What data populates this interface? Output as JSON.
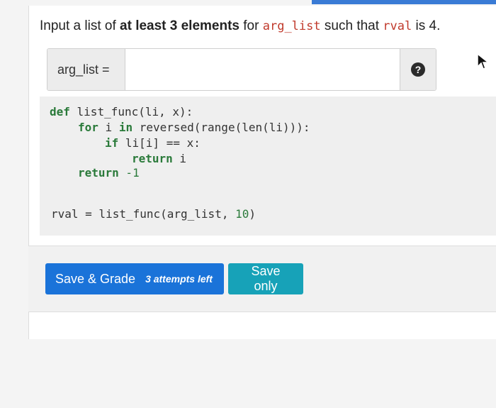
{
  "question": {
    "text_before": "Input a list of ",
    "bold": "at least 3 elements",
    "text_mid": " for ",
    "var1": "arg_list",
    "text_mid2": " such that ",
    "var2": "rval",
    "text_after": " is ",
    "value": "4."
  },
  "input": {
    "label": "arg_list =",
    "value": "",
    "help": "?"
  },
  "code": {
    "line1_kw": "def",
    "line1_rest": " list_func(li, x):",
    "line2_kw1": "for",
    "line2_mid": " i ",
    "line2_kw2": "in",
    "line2_rest": " reversed(range(len(li))):",
    "line3_kw": "if",
    "line3_rest": " li[i] == x:",
    "line4_kw": "return",
    "line4_rest": " i",
    "line5_kw": "return",
    "line5_num": " -1",
    "line6_rest": "rval = list_func(arg_list, ",
    "line6_num": "10",
    "line6_end": ")"
  },
  "buttons": {
    "save_grade": "Save & Grade",
    "attempts": "3 attempts left",
    "save_only": "Save only"
  },
  "colors": {
    "primary": "#1a73d9",
    "info": "#17a2b8",
    "code_var": "#c0392b"
  }
}
